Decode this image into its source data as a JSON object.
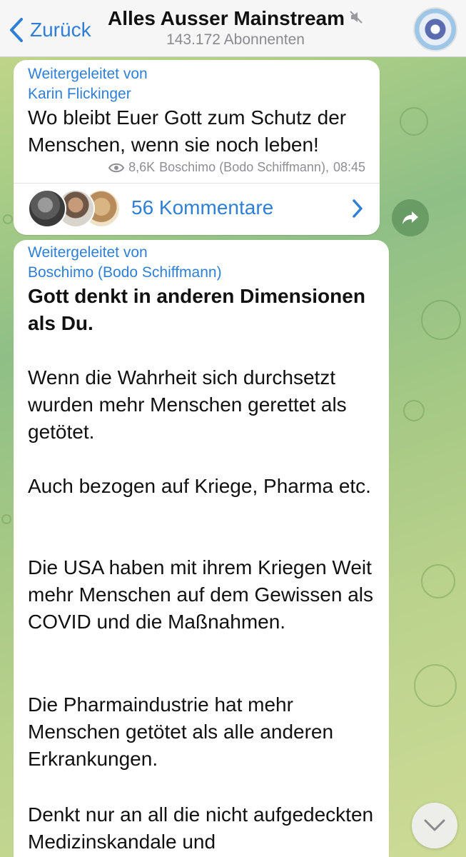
{
  "header": {
    "back_label": "Zurück",
    "title": "Alles Ausser Mainstream",
    "subtitle": "143.172 Abonnenten",
    "muted": true
  },
  "messages": [
    {
      "forwarded_prefix": "Weitergeleitet von",
      "forwarded_from": "Karin Flickinger",
      "text": "Wo bleibt Euer Gott zum Schutz der Menschen, wenn sie noch leben!",
      "views": "8,6K",
      "author": "Boschimo (Bodo Schiffmann)",
      "time": "08:45",
      "comments_label": "56 Kommentare"
    },
    {
      "forwarded_prefix": "Weitergeleitet von",
      "forwarded_from": "Boschimo (Bodo Schiffmann)",
      "bold_text": "Gott denkt in anderen Dimensionen als Du.",
      "paragraphs": [
        "Wenn die Wahrheit sich durchsetzt wurden mehr Menschen gerettet als getötet.",
        "Auch bezogen auf Kriege, Pharma etc.",
        "Die USA haben mit ihrem Kriegen Weit mehr Menschen auf dem Gewissen als COVID und die Maßnahmen.",
        "Die Pharmaindustrie hat mehr Menschen getötet als alle anderen Erkrankungen.",
        "Denkt nur an all die nicht aufgedeckten Medizinskandale und"
      ]
    }
  ],
  "icons": {
    "back": "chevron-left-icon",
    "mute": "muted-speaker-icon",
    "views": "eye-icon",
    "comments_chevron": "chevron-right-icon",
    "share": "share-arrow-icon",
    "scroll": "chevron-down-icon"
  },
  "colors": {
    "accent": "#2f7fd6",
    "header_bg": "#f6f6f6",
    "bubble_bg": "#ffffff",
    "meta_gray": "#8e8e93"
  }
}
